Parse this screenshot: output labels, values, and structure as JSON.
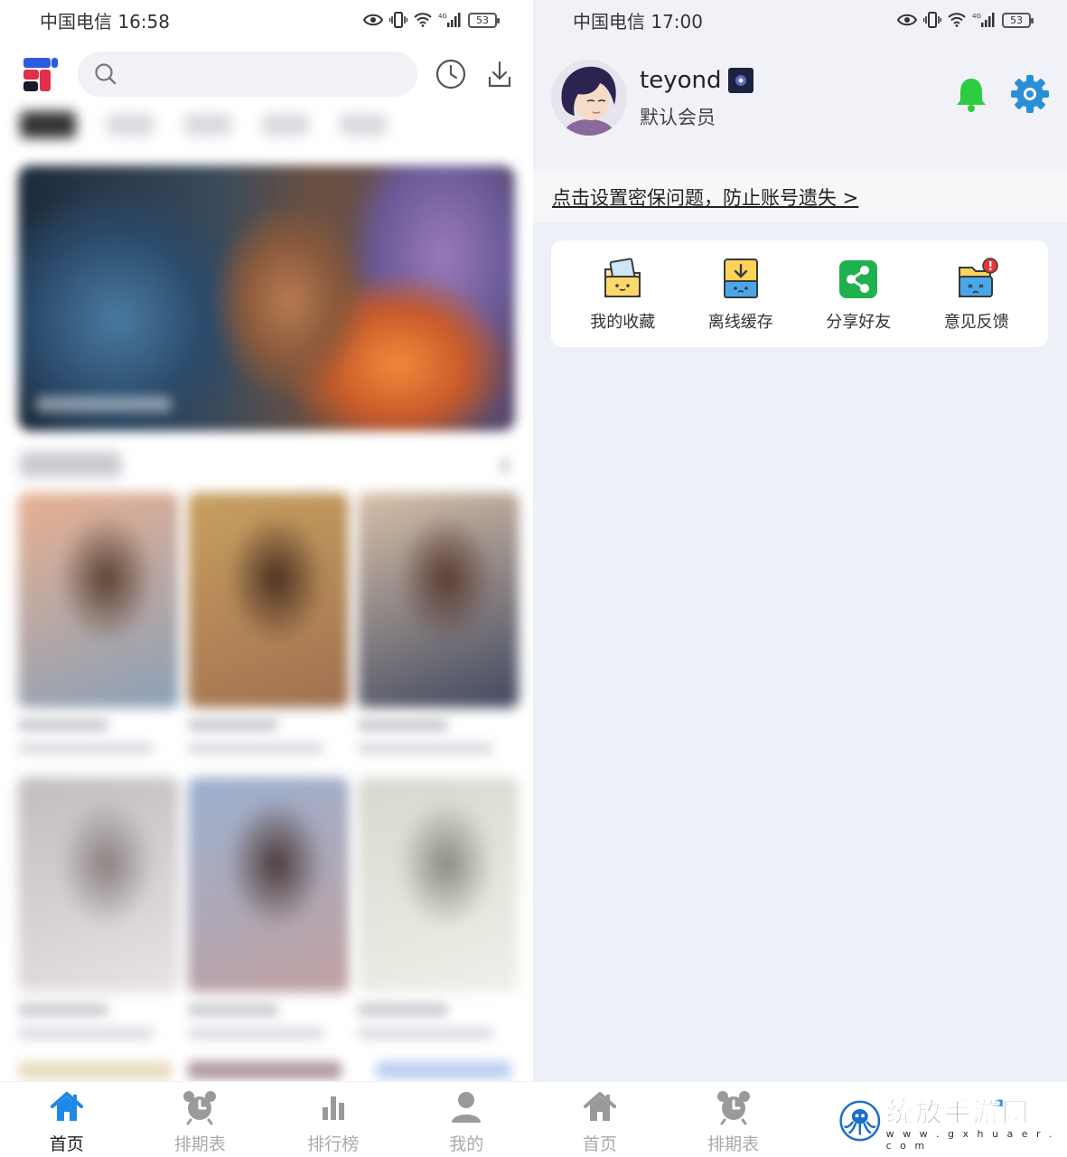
{
  "left": {
    "status": {
      "carrier_time": "中国电信 16:58",
      "network": "4G",
      "battery": "53"
    },
    "banner": {
      "colors": [
        "#1c2a3a",
        "#b97a52",
        "#f08a3a",
        "#9a7ab8",
        "#4a7aa0"
      ]
    },
    "posters": [
      {
        "colors": [
          "#e8b090",
          "#5a4030",
          "#8aa0b8"
        ]
      },
      {
        "colors": [
          "#c8a060",
          "#4a3020",
          "#a07050"
        ]
      },
      {
        "colors": [
          "#d8c0a8",
          "#5a3a30",
          "#404860"
        ]
      },
      {
        "colors": [
          "#c0bcc0",
          "#8a8080",
          "#e8e4e4"
        ]
      },
      {
        "colors": [
          "#9ab0d0",
          "#4a3a3a",
          "#c0a0a0"
        ]
      },
      {
        "colors": [
          "#d8d8d0",
          "#8a8a80",
          "#f0f0ea"
        ]
      }
    ],
    "tabbar": [
      {
        "label": "首页",
        "icon": "home-icon",
        "active": true
      },
      {
        "label": "排期表",
        "icon": "alarm-clock-icon",
        "active": false
      },
      {
        "label": "排行榜",
        "icon": "bar-chart-icon",
        "active": false
      },
      {
        "label": "我的",
        "icon": "person-icon",
        "active": false
      }
    ],
    "accent": "#1e88e5"
  },
  "right": {
    "status": {
      "carrier_time": "中国电信 17:00",
      "network": "4G",
      "battery": "53"
    },
    "profile": {
      "username": "teyond",
      "member_level": "默认会员"
    },
    "security_link": "点击设置密保问题，防止账号遗失 >",
    "quick_actions": [
      {
        "label": "我的收藏",
        "icon": "favorites-folder-icon"
      },
      {
        "label": "离线缓存",
        "icon": "offline-cache-icon"
      },
      {
        "label": "分享好友",
        "icon": "share-icon"
      },
      {
        "label": "意见反馈",
        "icon": "feedback-icon"
      }
    ],
    "tabbar": [
      {
        "label": "首页",
        "icon": "home-icon"
      },
      {
        "label": "排期表",
        "icon": "alarm-clock-icon"
      }
    ],
    "colors": {
      "bell": "#2ecc40",
      "gear": "#2a8fd6"
    }
  },
  "watermark": {
    "title": "统放手游网",
    "url": "w w w . g x h u a e r . c o m"
  }
}
